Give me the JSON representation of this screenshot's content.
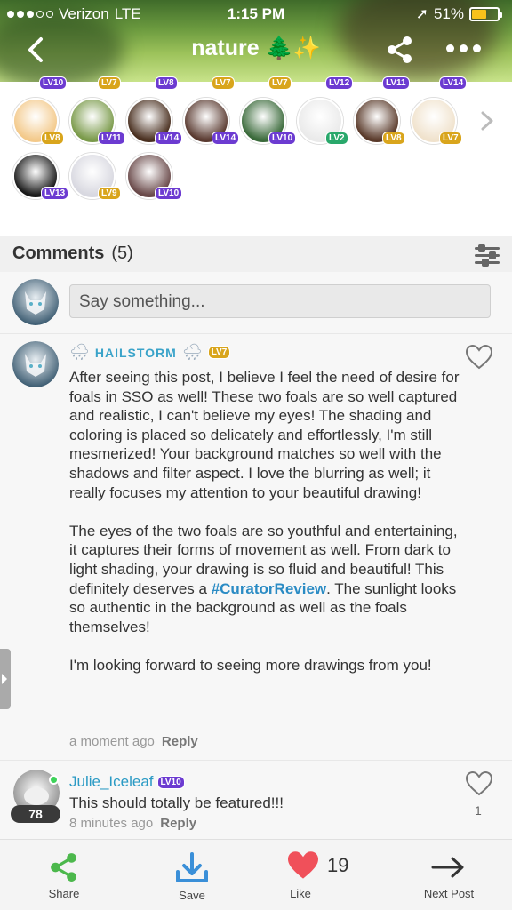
{
  "status_bar": {
    "carrier": "Verizon",
    "network": "LTE",
    "time": "1:15 PM",
    "battery": "51%"
  },
  "header": {
    "title": "nature 🌲✨",
    "back_icon": "chevron-left-icon",
    "share_icon": "share-icon",
    "more_icon": "more-dots-icon"
  },
  "members": {
    "top_row_levels": [
      "LV10",
      "LV7",
      "LV8",
      "LV7",
      "LV7",
      "LV12",
      "LV11",
      "LV14"
    ],
    "row1": [
      {
        "level": "LV8",
        "badge": "gold",
        "color": "#f3c98a"
      },
      {
        "level": "LV11",
        "badge": "purple",
        "color": "#7a9a4a"
      },
      {
        "level": "LV14",
        "badge": "purple",
        "color": "#4a3020"
      },
      {
        "level": "LV14",
        "badge": "purple",
        "color": "#5a3a30"
      },
      {
        "level": "LV10",
        "badge": "purple",
        "color": "#3a6a3a"
      },
      {
        "level": "LV2",
        "badge": "green",
        "color": "#eaeaea"
      },
      {
        "level": "LV8",
        "badge": "gold",
        "color": "#5a3a2a"
      },
      {
        "level": "LV7",
        "badge": "gold",
        "color": "#f0e2cc"
      }
    ],
    "row2": [
      {
        "level": "LV13",
        "badge": "purple",
        "color": "#1a1a1a"
      },
      {
        "level": "LV9",
        "badge": "gold",
        "color": "#d8d8e0"
      },
      {
        "level": "LV10",
        "badge": "purple",
        "color": "#6a4a4a"
      }
    ]
  },
  "comments_section": {
    "title": "Comments",
    "count": "(5)"
  },
  "input": {
    "placeholder": "Say something..."
  },
  "comment1": {
    "username": "HAILSTORM",
    "level": "LV7",
    "paragraph1": "After seeing this post, I believe I feel the need of desire for foals in SSO as well! These two foals are so well captured and realistic, I can't believe my eyes! The shading and coloring is placed so delicately and effortlessly, I'm still mesmerized! Your background matches so well with the shadows and filter aspect. I love the blurring as well; it really focuses my attention to your beautiful drawing!",
    "paragraph2_a": "The eyes of the two foals are so youthful and entertaining, it captures their forms of movement as well. From dark to light shading, your drawing is so fluid and beautiful! This definitely deserves a ",
    "hashtag": "#CuratorReview",
    "paragraph2_b": ". The sunlight looks so authentic in the background as well as the foals themselves!",
    "paragraph3": "I'm looking forward to seeing more drawings from you!",
    "time": "a moment ago",
    "reply": "Reply"
  },
  "comment2": {
    "username": "Julie_Iceleaf",
    "level": "LV10",
    "badge_count": "78",
    "text": "This should totally be featured!!!",
    "time": "8 minutes ago",
    "reply": "Reply",
    "likes": "1"
  },
  "bottom_bar": {
    "share": "Share",
    "save": "Save",
    "like": "Like",
    "like_count": "19",
    "next": "Next Post"
  },
  "colors": {
    "accent_blue": "#2a9ac4",
    "share_green": "#4cb84c",
    "save_blue": "#3a8fd8",
    "heart_red": "#f0505a"
  }
}
